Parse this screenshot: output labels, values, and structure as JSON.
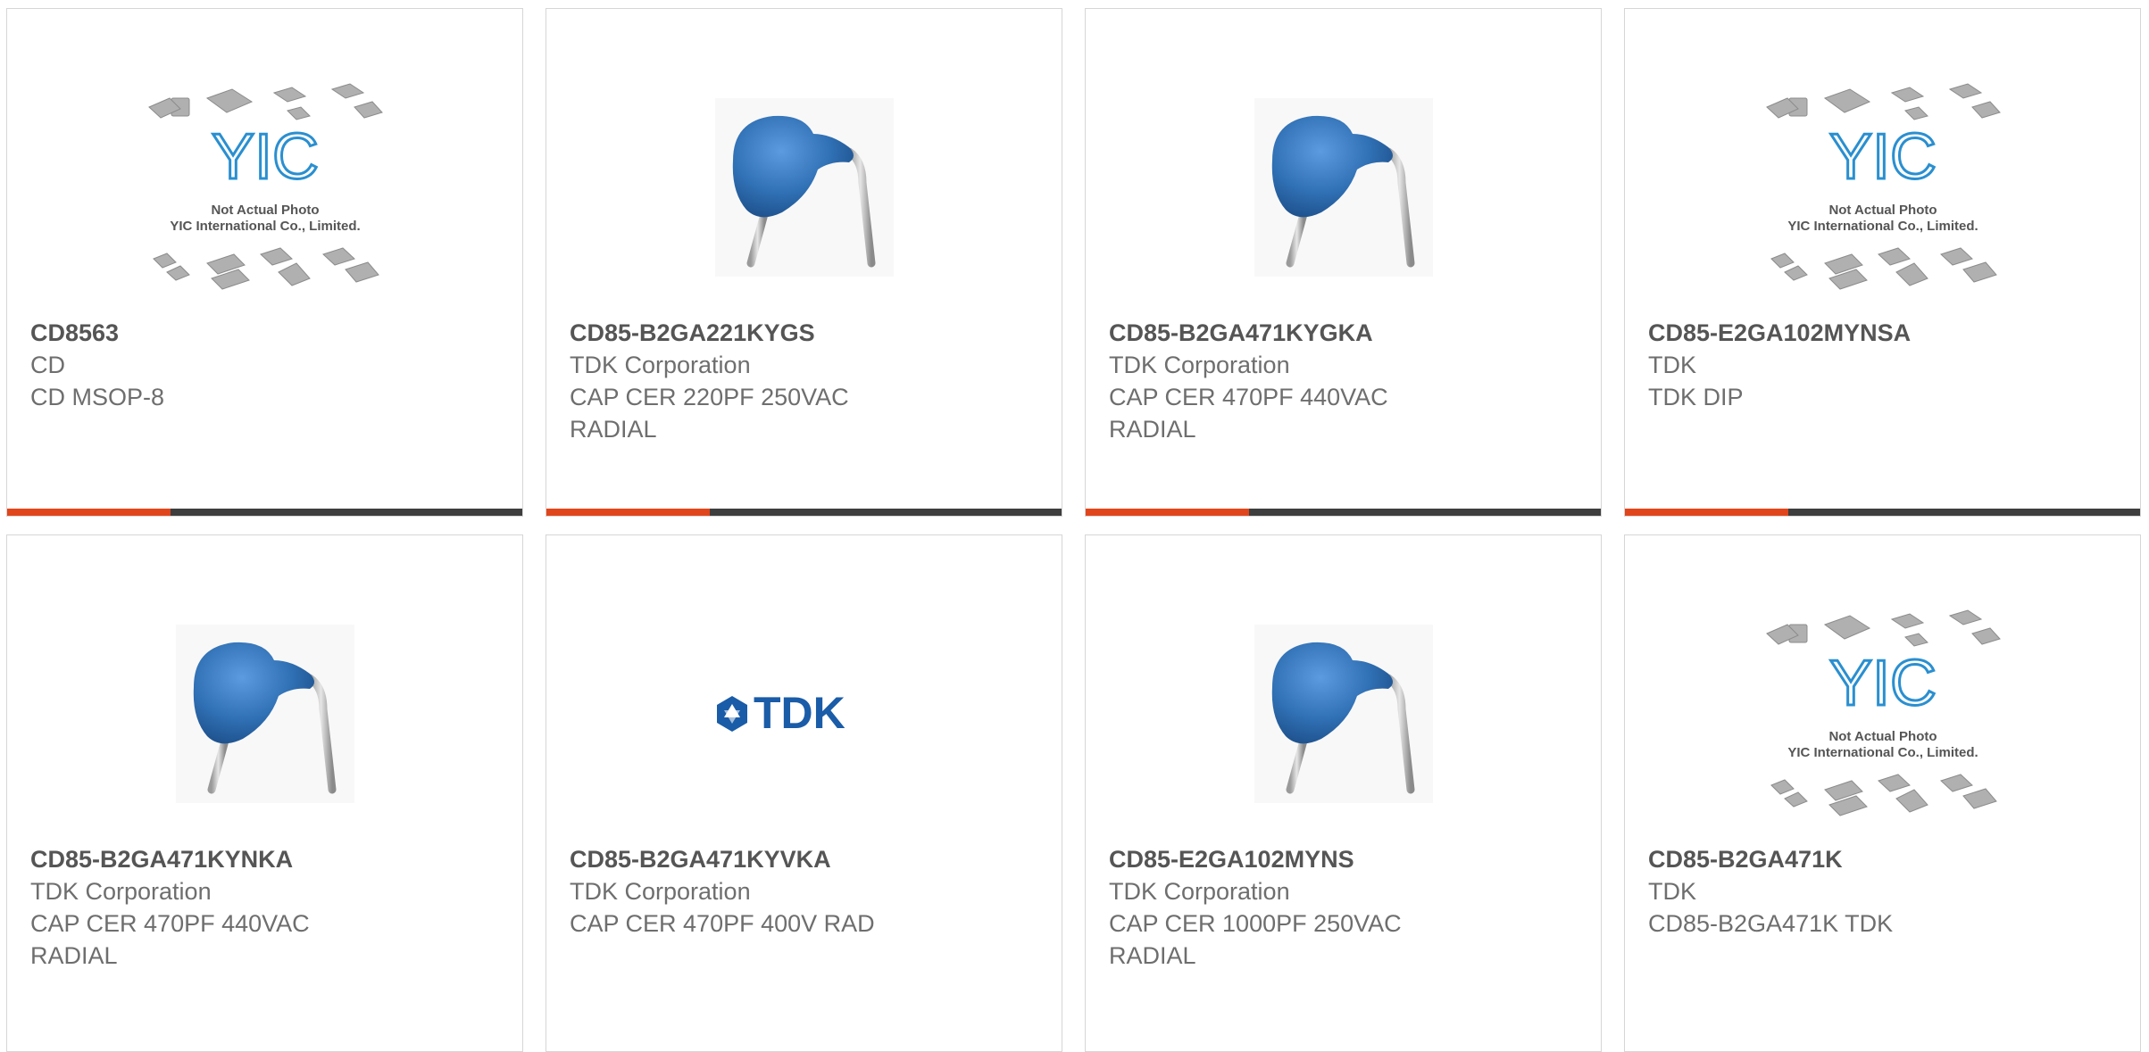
{
  "products": [
    {
      "part_number": "CD8563",
      "manufacturer": "CD",
      "description": "CD MSOP-8",
      "image": "placeholder-yic"
    },
    {
      "part_number": "CD85-B2GA221KYGS",
      "manufacturer": "TDK Corporation",
      "description": "CAP CER 220PF 250VAC RADIAL",
      "image": "ceramic-capacitor"
    },
    {
      "part_number": "CD85-B2GA471KYGKA",
      "manufacturer": "TDK Corporation",
      "description": "CAP CER 470PF 440VAC RADIAL",
      "image": "ceramic-capacitor"
    },
    {
      "part_number": "CD85-E2GA102MYNSA",
      "manufacturer": "TDK",
      "description": "TDK DIP",
      "image": "placeholder-yic"
    },
    {
      "part_number": "CD85-B2GA471KYNKA",
      "manufacturer": "TDK Corporation",
      "description": "CAP CER 470PF 440VAC RADIAL",
      "image": "ceramic-capacitor"
    },
    {
      "part_number": "CD85-B2GA471KYVKA",
      "manufacturer": "TDK Corporation",
      "description": "CAP CER 470PF 400V RAD",
      "image": "tdk-logo"
    },
    {
      "part_number": "CD85-E2GA102MYNS",
      "manufacturer": "TDK Corporation",
      "description": "CAP CER 1000PF 250VAC RADIAL",
      "image": "ceramic-capacitor"
    },
    {
      "part_number": "CD85-B2GA471K",
      "manufacturer": "TDK",
      "description": "CD85-B2GA471K TDK",
      "image": "placeholder-yic"
    }
  ],
  "placeholder": {
    "logo_text": "YIC",
    "line1": "Not Actual Photo",
    "line2": "YIC International Co., Limited."
  },
  "tdk_logo_text": "TDK",
  "colors": {
    "accent": "#e1451b",
    "bar": "#3e3e3e",
    "capacitor": "#2f6fb3",
    "tdk_blue": "#1a5ca8"
  }
}
